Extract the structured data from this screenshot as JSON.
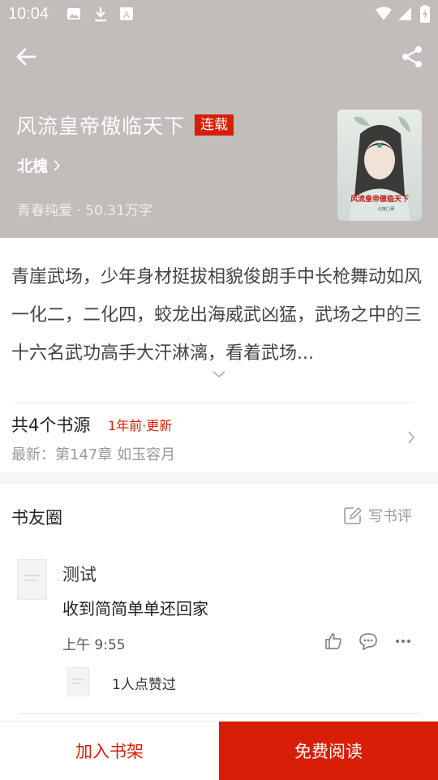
{
  "status_bar": {
    "time": "10:04"
  },
  "book": {
    "title": "风流皇帝傲临天下",
    "status_badge": "连载",
    "author": "北槐",
    "category": "青春纯爱",
    "word_count": "50.31万字",
    "meta_separator": " · ",
    "cover_text": "风流皇帝傲临天下",
    "cover_author": "北槐◯著"
  },
  "intro": {
    "text": "青崖武场，少年身材挺拔相貌俊朗手中长枪舞动如风一化二，二化四，蛟龙出海威武凶猛，武场之中的三十六名武功高手大汗淋漓，看着武场..."
  },
  "sources": {
    "count_label": "共4个书源",
    "update_label": "1年前·更新",
    "latest_label": "最新：第147章 如玉容月"
  },
  "circle": {
    "title": "书友圈",
    "write_review_label": "写书评",
    "comment": {
      "user": "测试",
      "text": "收到简简单单还回家",
      "time": "上午 9:55"
    },
    "likes_text": "1人点赞过"
  },
  "bottom_bar": {
    "add_shelf_label": "加入书架",
    "free_read_label": "免费阅读"
  },
  "colors": {
    "accent": "#d81e06",
    "hero_bg": "#c2bcbb"
  }
}
